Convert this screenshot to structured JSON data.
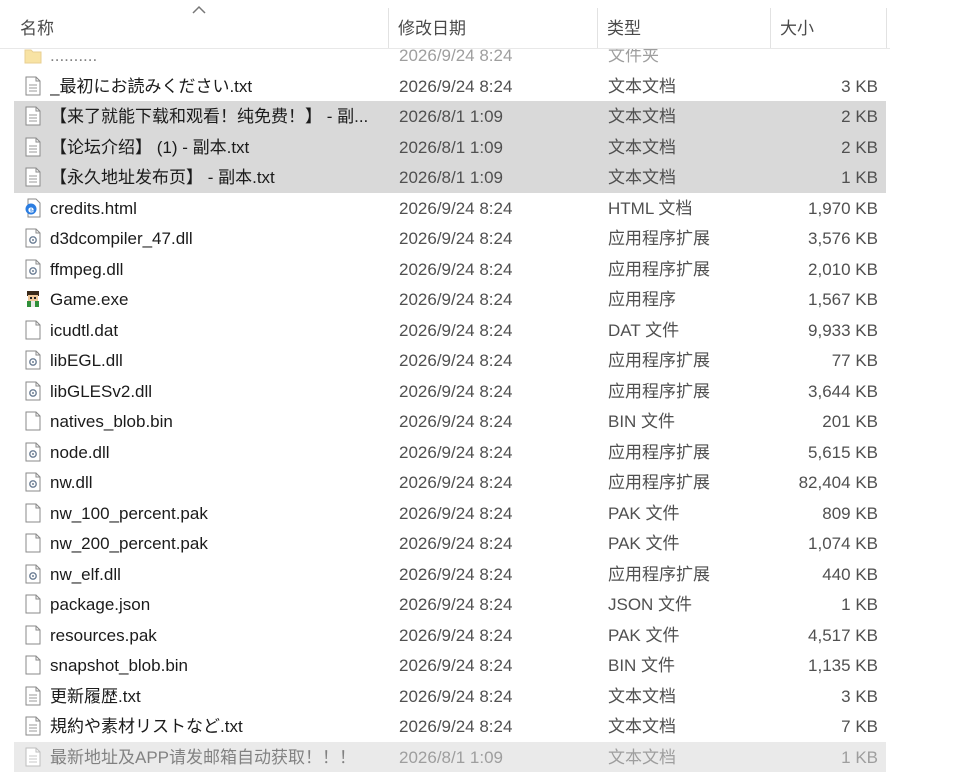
{
  "columns": {
    "name": "名称",
    "date": "修改日期",
    "type": "类型",
    "size": "大小"
  },
  "files": [
    {
      "icon": "folder-icon",
      "name": "..........",
      "date": "2026/9/24 8:24",
      "type": "文件夹",
      "size": "",
      "selected": false,
      "partial": "top"
    },
    {
      "icon": "text-file-icon",
      "name": "_最初にお読みください.txt",
      "date": "2026/9/24 8:24",
      "type": "文本文档",
      "size": "3 KB",
      "selected": false
    },
    {
      "icon": "text-file-icon",
      "name": "【来了就能下载和观看！纯免费！】 - 副...",
      "date": "2026/8/1 1:09",
      "type": "文本文档",
      "size": "2 KB",
      "selected": true
    },
    {
      "icon": "text-file-icon",
      "name": "【论坛介绍】 (1) - 副本.txt",
      "date": "2026/8/1 1:09",
      "type": "文本文档",
      "size": "2 KB",
      "selected": true
    },
    {
      "icon": "text-file-icon",
      "name": "【永久地址发布页】 - 副本.txt",
      "date": "2026/8/1 1:09",
      "type": "文本文档",
      "size": "1 KB",
      "selected": true
    },
    {
      "icon": "html-file-icon",
      "name": "credits.html",
      "date": "2026/9/24 8:24",
      "type": "HTML 文档",
      "size": "1,970 KB",
      "selected": false
    },
    {
      "icon": "dll-file-icon",
      "name": "d3dcompiler_47.dll",
      "date": "2026/9/24 8:24",
      "type": "应用程序扩展",
      "size": "3,576 KB",
      "selected": false
    },
    {
      "icon": "dll-file-icon",
      "name": "ffmpeg.dll",
      "date": "2026/9/24 8:24",
      "type": "应用程序扩展",
      "size": "2,010 KB",
      "selected": false
    },
    {
      "icon": "game-exe-icon",
      "name": "Game.exe",
      "date": "2026/9/24 8:24",
      "type": "应用程序",
      "size": "1,567 KB",
      "selected": false
    },
    {
      "icon": "blank-file-icon",
      "name": "icudtl.dat",
      "date": "2026/9/24 8:24",
      "type": "DAT 文件",
      "size": "9,933 KB",
      "selected": false
    },
    {
      "icon": "dll-file-icon",
      "name": "libEGL.dll",
      "date": "2026/9/24 8:24",
      "type": "应用程序扩展",
      "size": "77 KB",
      "selected": false
    },
    {
      "icon": "dll-file-icon",
      "name": "libGLESv2.dll",
      "date": "2026/9/24 8:24",
      "type": "应用程序扩展",
      "size": "3,644 KB",
      "selected": false
    },
    {
      "icon": "blank-file-icon",
      "name": "natives_blob.bin",
      "date": "2026/9/24 8:24",
      "type": "BIN 文件",
      "size": "201 KB",
      "selected": false
    },
    {
      "icon": "dll-file-icon",
      "name": "node.dll",
      "date": "2026/9/24 8:24",
      "type": "应用程序扩展",
      "size": "5,615 KB",
      "selected": false
    },
    {
      "icon": "dll-file-icon",
      "name": "nw.dll",
      "date": "2026/9/24 8:24",
      "type": "应用程序扩展",
      "size": "82,404 KB",
      "selected": false
    },
    {
      "icon": "blank-file-icon",
      "name": "nw_100_percent.pak",
      "date": "2026/9/24 8:24",
      "type": "PAK 文件",
      "size": "809 KB",
      "selected": false
    },
    {
      "icon": "blank-file-icon",
      "name": "nw_200_percent.pak",
      "date": "2026/9/24 8:24",
      "type": "PAK 文件",
      "size": "1,074 KB",
      "selected": false
    },
    {
      "icon": "dll-file-icon",
      "name": "nw_elf.dll",
      "date": "2026/9/24 8:24",
      "type": "应用程序扩展",
      "size": "440 KB",
      "selected": false
    },
    {
      "icon": "blank-file-icon",
      "name": "package.json",
      "date": "2026/9/24 8:24",
      "type": "JSON 文件",
      "size": "1 KB",
      "selected": false
    },
    {
      "icon": "blank-file-icon",
      "name": "resources.pak",
      "date": "2026/9/24 8:24",
      "type": "PAK 文件",
      "size": "4,517 KB",
      "selected": false
    },
    {
      "icon": "blank-file-icon",
      "name": "snapshot_blob.bin",
      "date": "2026/9/24 8:24",
      "type": "BIN 文件",
      "size": "1,135 KB",
      "selected": false
    },
    {
      "icon": "text-file-icon",
      "name": "更新履歴.txt",
      "date": "2026/9/24 8:24",
      "type": "文本文档",
      "size": "3 KB",
      "selected": false
    },
    {
      "icon": "text-file-icon",
      "name": "規約や素材リストなど.txt",
      "date": "2026/9/24 8:24",
      "type": "文本文档",
      "size": "7 KB",
      "selected": false
    },
    {
      "icon": "text-file-icon",
      "name": "最新地址及APP请发邮箱自动获取！！！",
      "date": "2026/8/1 1:09",
      "type": "文本文档",
      "size": "1 KB",
      "selected": true,
      "partial": "bottom"
    }
  ]
}
